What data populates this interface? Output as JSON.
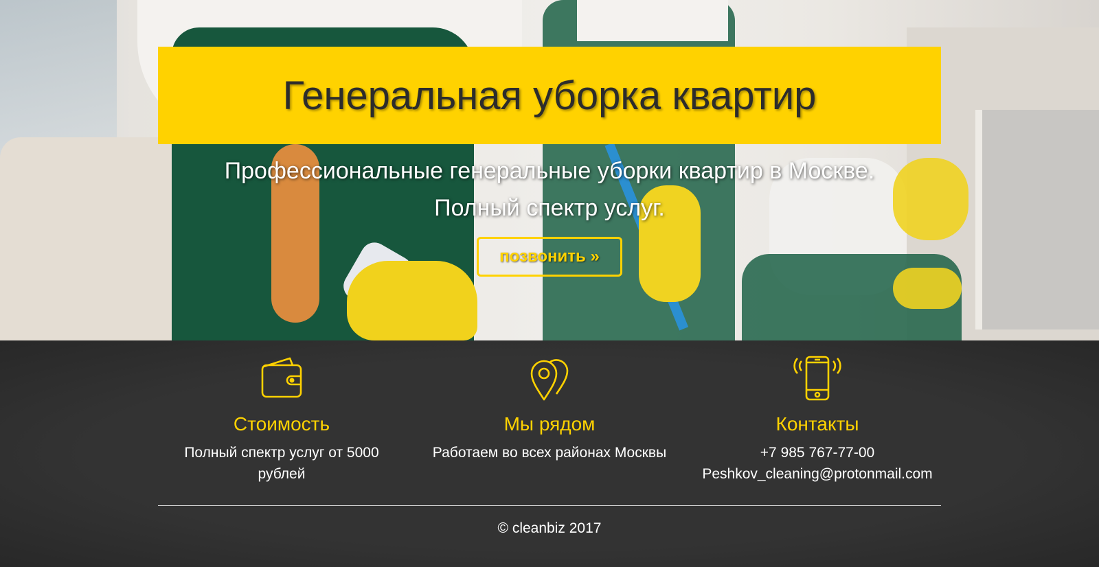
{
  "hero": {
    "title": "Генеральная уборка квартир",
    "subtitle_line1": "Профессиональные генеральные уборки квартир в Москве.",
    "subtitle_line2": "Полный спектр услуг.",
    "call_button": "позвонить »"
  },
  "features": [
    {
      "icon": "wallet-icon",
      "title": "Стоимость",
      "text_line1": "Полный спектр услуг от 5000",
      "text_line2": "рублей"
    },
    {
      "icon": "map-pins-icon",
      "title": "Мы рядом",
      "text_line1": "Работаем во всех районах Москвы"
    },
    {
      "icon": "smartphone-icon",
      "title": "Контакты",
      "text_line1": "+7 985 767-77-00",
      "text_line2": "Peshkov_cleaning@protonmail.com"
    }
  ],
  "footer": {
    "copyright": "© cleanbiz 2017"
  },
  "colors": {
    "accent": "#ffd200",
    "footer_bg": "#333333",
    "title_text": "#2c2c2c"
  }
}
